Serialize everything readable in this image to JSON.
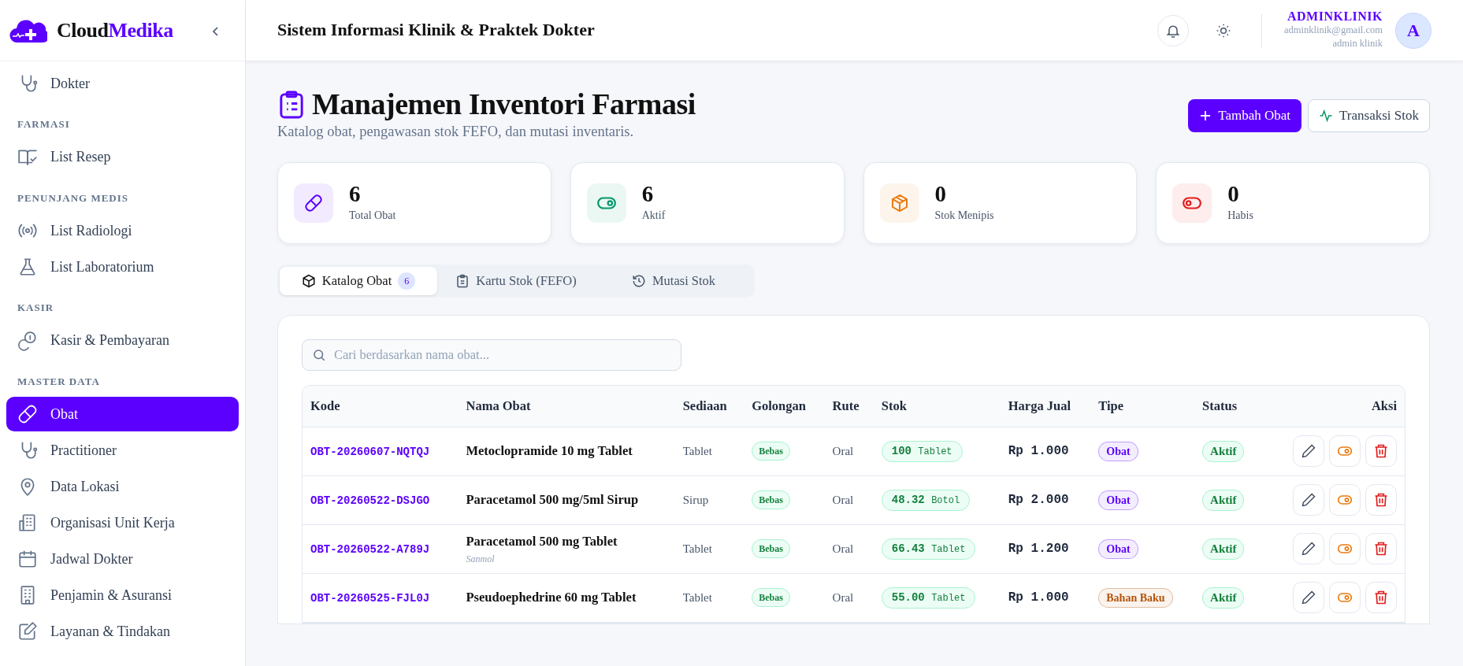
{
  "brand": {
    "first": "Cloud",
    "second": "Medika"
  },
  "sidebar": {
    "groups": [
      {
        "items": [
          {
            "label": "Dokter",
            "selected": false
          }
        ]
      },
      {
        "heading": "FARMASI",
        "items": [
          {
            "label": "List Resep",
            "selected": false
          }
        ]
      },
      {
        "heading": "PENUNJANG MEDIS",
        "items": [
          {
            "label": "List Radiologi",
            "selected": false
          },
          {
            "label": "List Laboratorium",
            "selected": false
          }
        ]
      },
      {
        "heading": "KASIR",
        "items": [
          {
            "label": "Kasir & Pembayaran",
            "selected": false
          }
        ]
      },
      {
        "heading": "MASTER DATA",
        "items": [
          {
            "label": "Obat",
            "selected": true
          },
          {
            "label": "Practitioner",
            "selected": false
          },
          {
            "label": "Data Lokasi",
            "selected": false
          },
          {
            "label": "Organisasi Unit Kerja",
            "selected": false
          },
          {
            "label": "Jadwal Dokter",
            "selected": false
          },
          {
            "label": "Penjamin & Asuransi",
            "selected": false
          },
          {
            "label": "Layanan & Tindakan",
            "selected": false
          }
        ]
      }
    ]
  },
  "header": {
    "title": "Sistem Informasi Klinik & Praktek Dokter",
    "user": {
      "name": "ADMINKLINIK",
      "email": "adminklinik@gmail.com",
      "role": "admin klinik",
      "initial": "A"
    }
  },
  "page": {
    "title": "Manajemen Inventori Farmasi",
    "subtitle": "Katalog obat, pengawasan stok FEFO, dan mutasi inventaris.",
    "buttons": [
      {
        "label": "Tambah Obat",
        "kind": "primary"
      },
      {
        "label": "Transaksi Stok",
        "kind": "outline"
      }
    ]
  },
  "stats": [
    {
      "value": "6",
      "label": "Total Obat",
      "color": "#5b00ff"
    },
    {
      "value": "6",
      "label": "Aktif",
      "color": "#059669"
    },
    {
      "value": "0",
      "label": "Stok Menipis",
      "color": "#ea7a0c"
    },
    {
      "value": "0",
      "label": "Habis",
      "color": "#e11d1d"
    }
  ],
  "tabs": [
    {
      "label": "Katalog Obat",
      "badge": "6",
      "selected": true
    },
    {
      "label": "Kartu Stok (FEFO)",
      "selected": false
    },
    {
      "label": "Mutasi Stok",
      "selected": false
    }
  ],
  "search": {
    "placeholder": "Cari berdasarkan nama obat..."
  },
  "table": {
    "columns": [
      "Kode",
      "Nama Obat",
      "Sediaan",
      "Golongan",
      "Rute",
      "Stok",
      "Harga Jual",
      "Tipe",
      "Status",
      "Aksi"
    ],
    "rows": [
      {
        "code": "OBT-20260607-NQTQJ",
        "name": "Metoclopramide 10 mg Tablet",
        "sediaan": "Tablet",
        "golongan": "Bebas",
        "rute": "Oral",
        "stok": "100",
        "unit": "Tablet",
        "harga": "Rp 1.000",
        "tipe": {
          "label": "Obat",
          "color": "#5b00ff"
        },
        "status": "Aktif"
      },
      {
        "code": "OBT-20260522-DSJGO",
        "name": "Paracetamol 500 mg/5ml Sirup",
        "sediaan": "Sirup",
        "golongan": "Bebas",
        "rute": "Oral",
        "stok": "48.32",
        "unit": "Botol",
        "harga": "Rp 2.000",
        "tipe": {
          "label": "Obat",
          "color": "#5b00ff"
        },
        "status": "Aktif"
      },
      {
        "code": "OBT-20260522-A789J",
        "name": "Paracetamol 500 mg Tablet",
        "brand": "Sanmol",
        "sediaan": "Tablet",
        "golongan": "Bebas",
        "rute": "Oral",
        "stok": "66.43",
        "unit": "Tablet",
        "harga": "Rp 1.200",
        "tipe": {
          "label": "Obat",
          "color": "#5b00ff"
        },
        "status": "Aktif"
      },
      {
        "code": "OBT-20260525-FJL0J",
        "name": "Pseudoephedrine 60 mg Tablet",
        "sediaan": "Tablet",
        "golongan": "Bebas",
        "rute": "Oral",
        "stok": "55.00",
        "unit": "Tablet",
        "harga": "Rp 1.000",
        "tipe": {
          "label": "Bahan Baku",
          "color": "#b45309"
        },
        "status": "Aktif"
      }
    ]
  }
}
